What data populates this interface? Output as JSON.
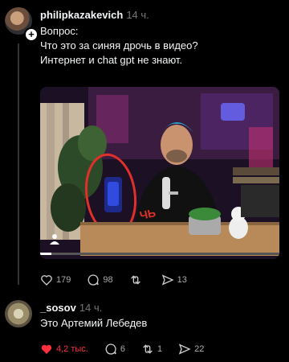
{
  "post": {
    "username": "philipkazakevich",
    "time": "14 ч.",
    "text_line1": "Вопрос:",
    "text_line2": "Что это за синяя дрочь в видео?",
    "text_line3": "Интернет и chat gpt не знают.",
    "image_annotation": "ЧЬ",
    "stats": {
      "likes": "179",
      "comments": "98",
      "reposts": "",
      "shares": "13"
    }
  },
  "reply": {
    "username": "_sosov",
    "time": "14 ч.",
    "text": "Это Артемий Лебедев",
    "stats": {
      "likes": "4,2 тыс.",
      "comments": "6",
      "reposts": "1",
      "shares": "22"
    }
  },
  "colors": {
    "like": "#ff3040",
    "annotation": "#e0302a"
  }
}
